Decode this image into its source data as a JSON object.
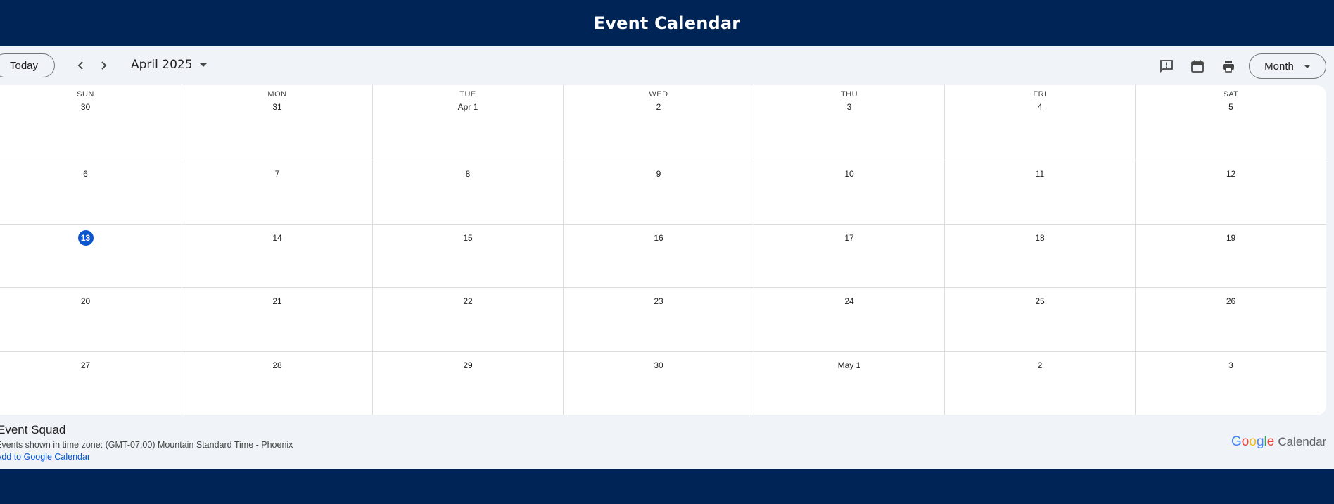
{
  "header": {
    "title": "Event Calendar"
  },
  "toolbar": {
    "today_label": "Today",
    "month_label": "April 2025",
    "view_label": "Month",
    "icons": [
      "feedback-icon",
      "calendar-icon",
      "print-icon",
      "chevron-left-icon",
      "chevron-right-icon"
    ]
  },
  "weekdays": [
    "SUN",
    "MON",
    "TUE",
    "WED",
    "THU",
    "FRI",
    "SAT"
  ],
  "weeks": [
    [
      "30",
      "31",
      "Apr 1",
      "2",
      "3",
      "4",
      "5"
    ],
    [
      "6",
      "7",
      "8",
      "9",
      "10",
      "11",
      "12"
    ],
    [
      "13",
      "14",
      "15",
      "16",
      "17",
      "18",
      "19"
    ],
    [
      "20",
      "21",
      "22",
      "23",
      "24",
      "25",
      "26"
    ],
    [
      "27",
      "28",
      "29",
      "30",
      "May 1",
      "2",
      "3"
    ]
  ],
  "today": "13",
  "footer": {
    "calendar_name": "Event Squad",
    "timezone_text": "Events shown in time zone: (GMT-07:00) Mountain Standard Time - Phoenix",
    "add_link": "Add to Google Calendar",
    "brand_word": "Calendar",
    "google_letters": [
      {
        "ch": "G",
        "color": "#4285F4"
      },
      {
        "ch": "o",
        "color": "#EA4335"
      },
      {
        "ch": "o",
        "color": "#FBBC05"
      },
      {
        "ch": "g",
        "color": "#4285F4"
      },
      {
        "ch": "l",
        "color": "#34A853"
      },
      {
        "ch": "e",
        "color": "#EA4335"
      }
    ]
  },
  "colors": {
    "header_bg": "#002455",
    "page_bg": "#f0f4f9",
    "today_accent": "#0b57d0",
    "link": "#0b57d0"
  }
}
